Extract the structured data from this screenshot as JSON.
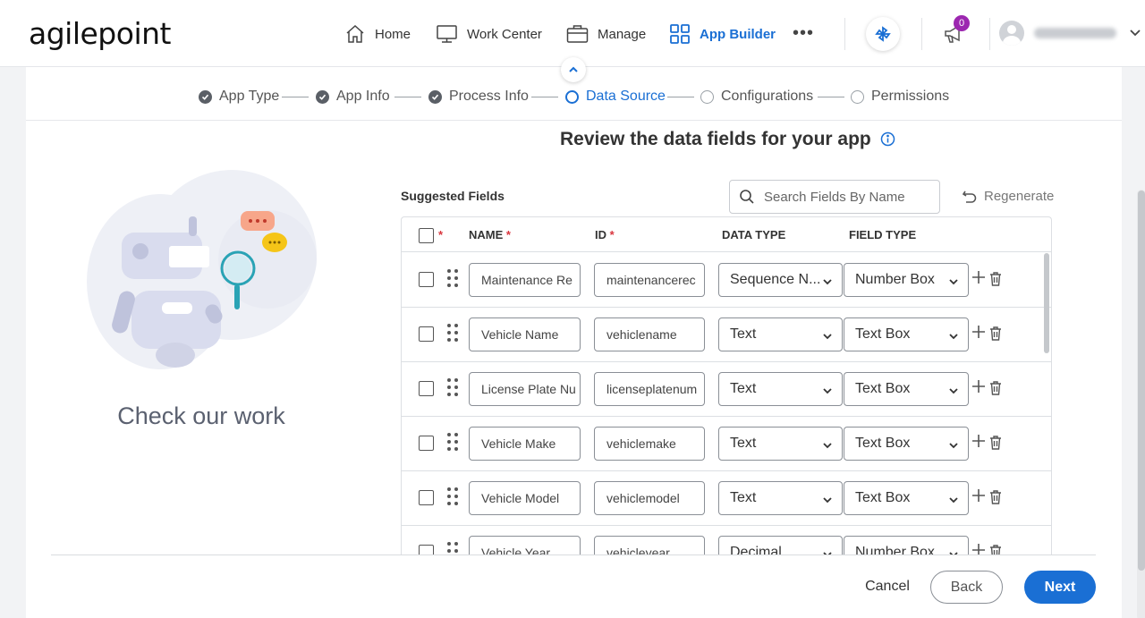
{
  "brand": {
    "logo_text": "agilepoint",
    "accent": "#1a6fd4"
  },
  "nav": {
    "items": [
      {
        "label": "Home",
        "icon": "home-icon"
      },
      {
        "label": "Work Center",
        "icon": "monitor-icon"
      },
      {
        "label": "Manage",
        "icon": "briefcase-icon"
      },
      {
        "label": "App Builder",
        "icon": "grid-icon",
        "active": true
      }
    ],
    "more": "•••",
    "notification_count": "0"
  },
  "stepper": {
    "steps": [
      {
        "label": "App Type",
        "state": "done"
      },
      {
        "label": "App Info",
        "state": "done"
      },
      {
        "label": "Process Info",
        "state": "done"
      },
      {
        "label": "Data Source",
        "state": "current"
      },
      {
        "label": "Configurations",
        "state": "todo"
      },
      {
        "label": "Permissions",
        "state": "todo"
      }
    ]
  },
  "left": {
    "caption": "Check our work"
  },
  "main": {
    "title": "Review the data fields for your app",
    "suggested_label": "Suggested Fields",
    "search_placeholder": "Search Fields By Name",
    "regenerate": "Regenerate",
    "columns": {
      "name": "NAME",
      "id": "ID",
      "data_type": "DATA TYPE",
      "field_type": "FIELD TYPE",
      "required_mark": "*"
    },
    "rows": [
      {
        "name": "Maintenance Re",
        "id": "maintenancerec",
        "data_type": "Sequence N...",
        "field_type": "Number Box"
      },
      {
        "name": "Vehicle Name",
        "id": "vehiclename",
        "data_type": "Text",
        "field_type": "Text Box"
      },
      {
        "name": "License Plate Nu",
        "id": "licenseplatenum",
        "data_type": "Text",
        "field_type": "Text Box"
      },
      {
        "name": "Vehicle Make",
        "id": "vehiclemake",
        "data_type": "Text",
        "field_type": "Text Box"
      },
      {
        "name": "Vehicle Model",
        "id": "vehiclemodel",
        "data_type": "Text",
        "field_type": "Text Box"
      },
      {
        "name": "Vehicle Year",
        "id": "vehicleyear",
        "data_type": "Decimal",
        "field_type": "Number Box"
      }
    ]
  },
  "footer": {
    "cancel": "Cancel",
    "back": "Back",
    "next": "Next"
  }
}
